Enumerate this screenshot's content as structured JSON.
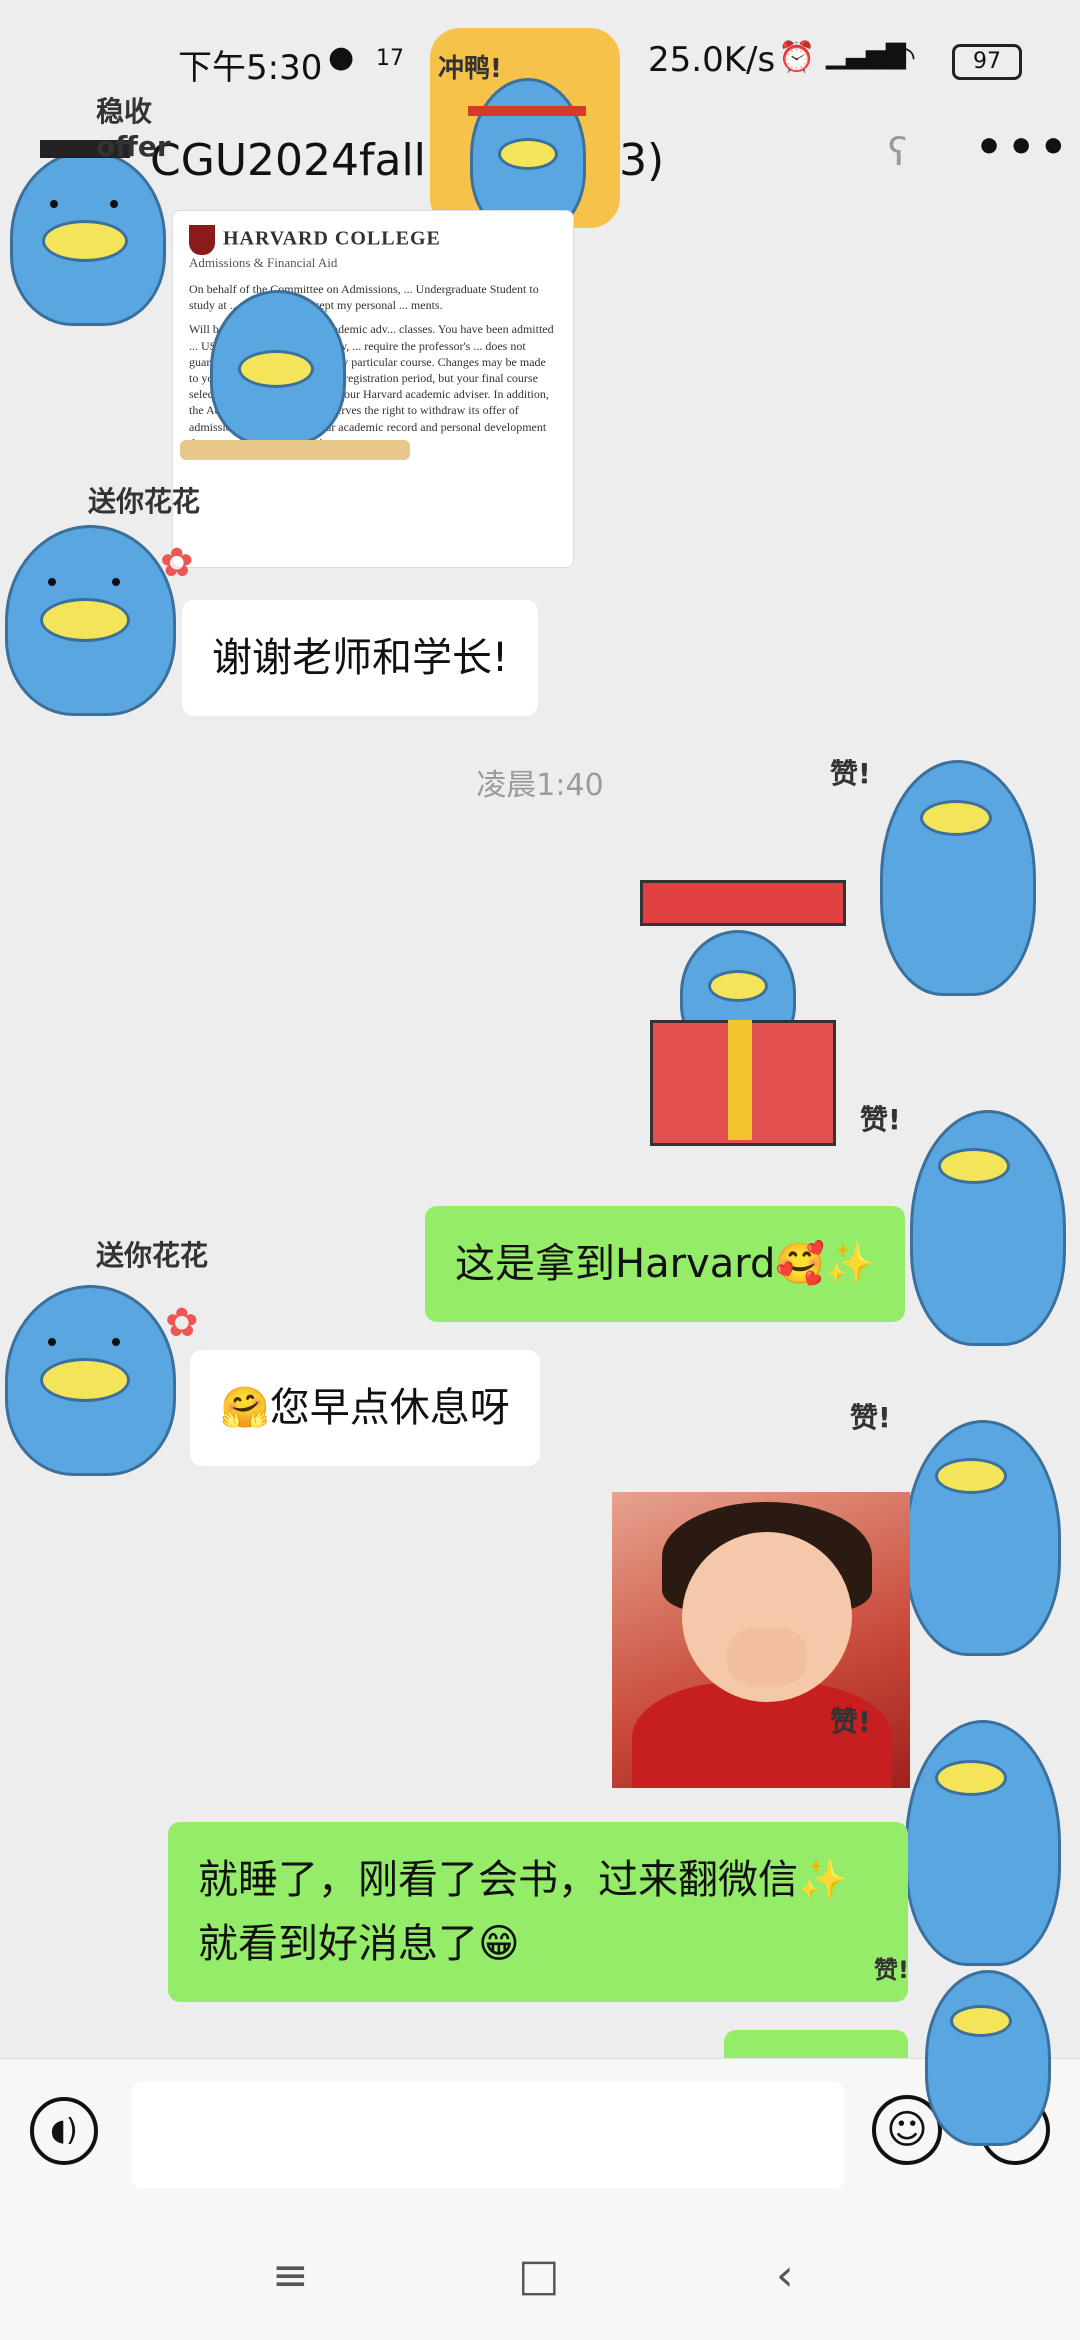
{
  "status_bar": {
    "time": "下午5:30",
    "net_speed": "25.0K/s",
    "battery": "97",
    "icons": [
      "notification-dot-icon",
      "calendar-icon",
      "alarm-icon",
      "hd-signal-icon",
      "wifi-icon",
      "battery-icon"
    ],
    "calendar_day": "17"
  },
  "header": {
    "title": "CGU2024fall申请小组(3)",
    "more_label": "•••"
  },
  "letter": {
    "org": "HARVARD COLLEGE",
    "dept": "Admissions & Financial Aid",
    "p1": "On behalf of the Committee on Admissions, ... Undergraduate Student to study at ... term. Please accept my personal ... ments.",
    "p2": "Will be assigned a Harvard academic adv... classes. You have been admitted ... USD per course. As you know, ... require the professor's ... does not guarantee your enrollment in any particular course. Changes may be made to your plan of study during the registration period, but your final course selection must be approved by your Harvard academic adviser. In addition, the Admissions Committee reserves the right to withdraw its offer of admission if, at any time, your academic record and personal development do not continue as expected."
  },
  "stickers": {
    "steady_offer": "稳收offer",
    "flower": "送你花花",
    "charge": "冲鸭!",
    "like": "赞!"
  },
  "messages": [
    {
      "side": "left",
      "text": "谢谢老师和学长!"
    },
    {
      "side": "right",
      "text": "这是拿到Harvard🥰✨"
    },
    {
      "side": "left",
      "text": "🤗您早点休息呀"
    },
    {
      "side": "right",
      "text": "就睡了，刚看了会书，过来翻微信✨就看到好消息了😁"
    }
  ],
  "timestamp": "凌晨1:40",
  "input": {
    "placeholder": "",
    "emoji_glyph": "☺",
    "plus_glyph": "+"
  },
  "nav": {
    "menu": "≡",
    "home": "□",
    "back": "‹"
  },
  "colors": {
    "outgoing_bubble": "#95ec69",
    "incoming_bubble": "#ffffff",
    "background": "#ededed"
  }
}
